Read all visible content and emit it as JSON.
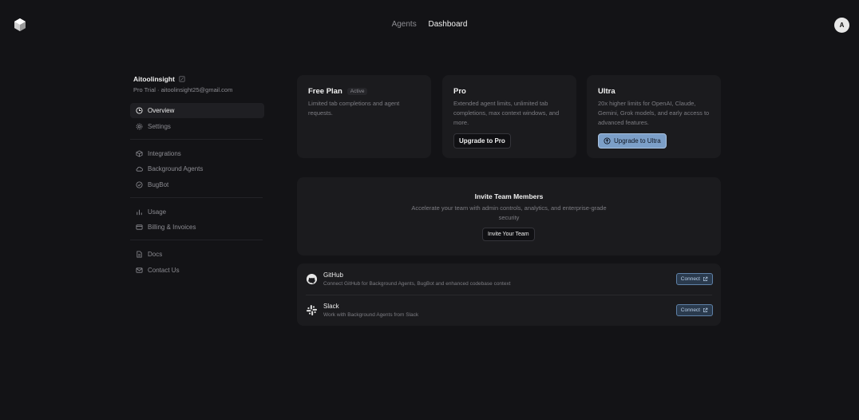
{
  "nav": {
    "agents": "Agents",
    "dashboard": "Dashboard",
    "avatar_letter": "A"
  },
  "account": {
    "name": "Aitoolinsight",
    "subtitle": "Pro Trial · aitoolinsight25@gmail.com"
  },
  "sidebar": {
    "items": [
      {
        "label": "Overview",
        "icon": "clock-icon",
        "selected": true
      },
      {
        "label": "Settings",
        "icon": "gear-icon"
      },
      {
        "label": "Integrations",
        "icon": "cube-icon"
      },
      {
        "label": "Background Agents",
        "icon": "cloud-icon"
      },
      {
        "label": "BugBot",
        "icon": "check-circle-icon"
      },
      {
        "label": "Usage",
        "icon": "bar-chart-icon"
      },
      {
        "label": "Billing & Invoices",
        "icon": "credit-card-icon"
      },
      {
        "label": "Docs",
        "icon": "document-icon"
      },
      {
        "label": "Contact Us",
        "icon": "mail-icon"
      }
    ]
  },
  "plans": {
    "free": {
      "title": "Free Plan",
      "badge": "Active",
      "desc": "Limited tab completions and agent requests."
    },
    "pro": {
      "title": "Pro",
      "desc": "Extended agent limits, unlimited tab completions, max context windows, and more.",
      "button": "Upgrade to Pro"
    },
    "ultra": {
      "title": "Ultra",
      "desc": "20x higher limits for OpenAI, Claude, Gemini, Grok models, and early access to advanced features.",
      "button": "Upgrade to Ultra"
    }
  },
  "invite": {
    "title": "Invite Team Members",
    "desc": "Accelerate your team with admin controls, analytics, and enterprise-grade security",
    "button": "Invite Your Team"
  },
  "integrations": [
    {
      "name": "GitHub",
      "desc": "Connect GitHub for Background Agents, BugBot and enhanced codebase context",
      "button": "Connect",
      "icon": "github-icon"
    },
    {
      "name": "Slack",
      "desc": "Work with Background Agents from Slack",
      "button": "Connect",
      "icon": "slack-icon"
    }
  ],
  "colors": {
    "background": "#131316",
    "card": "#1b1b1e",
    "accent": "#7c9fc8"
  }
}
